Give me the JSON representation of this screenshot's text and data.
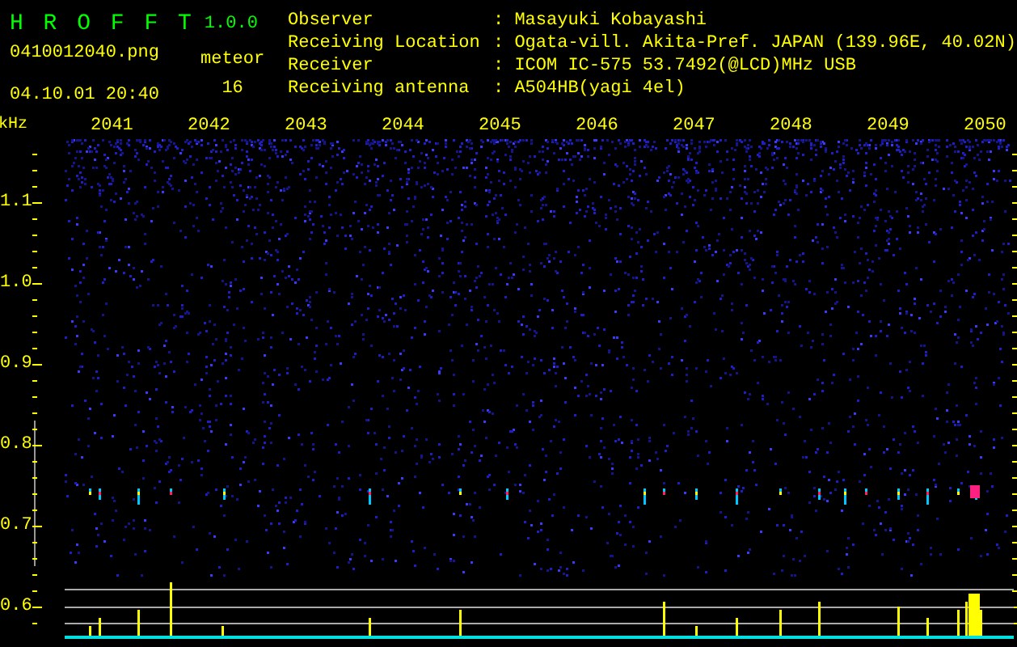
{
  "app": {
    "title": "H R O F F T",
    "version": "1.0.0",
    "file": "0410012040.png",
    "datetime": "04.10.01 20:40",
    "count_label": "meteor",
    "count": "16"
  },
  "info": [
    {
      "label": "Observer",
      "value": ": Masayuki Kobayashi"
    },
    {
      "label": "Receiving Location",
      "value": ": Ogata-vill. Akita-Pref. JAPAN (139.96E, 40.02N)"
    },
    {
      "label": "Receiver",
      "value": ": ICOM IC-575 53.7492(@LCD)MHz USB"
    },
    {
      "label": "Receiving antenna",
      "value": ": A504HB(yagi 4el)"
    }
  ],
  "plot": {
    "unit": "kHz",
    "time_labels": [
      "2041",
      "2042",
      "2043",
      "2044",
      "2045",
      "2046",
      "2047",
      "2048",
      "2049",
      "2050"
    ],
    "frequency_labels": [
      "1.1",
      "1.0",
      "0.9",
      "0.8",
      "0.7",
      "0.6"
    ]
  }
}
